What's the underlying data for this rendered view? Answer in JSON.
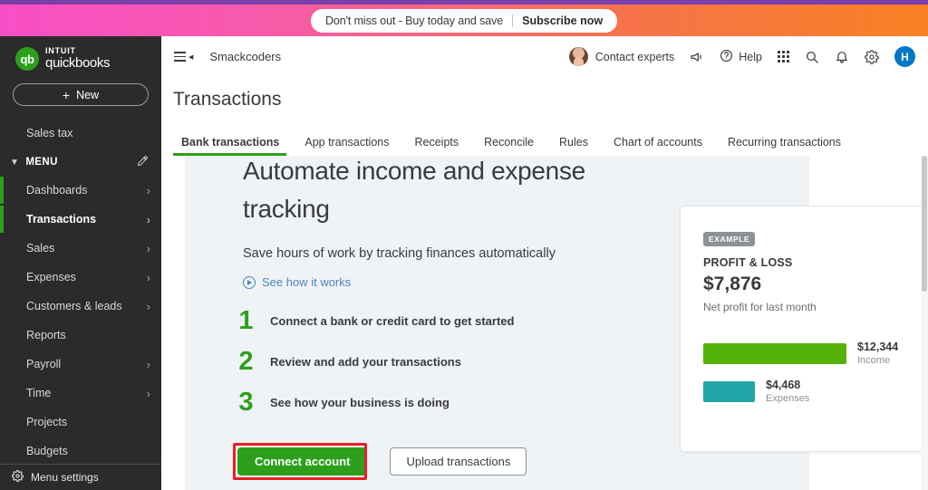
{
  "promo": {
    "message": "Don't miss out - Buy today and save",
    "cta": "Subscribe now"
  },
  "brand": {
    "intuit": "INTUIT",
    "product": "quickbooks",
    "mark": "qb"
  },
  "sidebar": {
    "new_button": "New",
    "new_plus": "+",
    "sales_tax": "Sales tax",
    "menu_group": "MENU",
    "items": [
      {
        "label": "Dashboards",
        "chevron": "›",
        "active": false
      },
      {
        "label": "Transactions",
        "chevron": "›",
        "active": true
      },
      {
        "label": "Sales",
        "chevron": "›",
        "active": false
      },
      {
        "label": "Expenses",
        "chevron": "›",
        "active": false
      },
      {
        "label": "Customers & leads",
        "chevron": "›",
        "active": false
      },
      {
        "label": "Reports",
        "chevron": "",
        "active": false
      },
      {
        "label": "Payroll",
        "chevron": "›",
        "active": false
      },
      {
        "label": "Time",
        "chevron": "›",
        "active": false
      },
      {
        "label": "Projects",
        "chevron": "",
        "active": false
      },
      {
        "label": "Budgets",
        "chevron": "",
        "active": false
      }
    ],
    "footer": "Menu settings"
  },
  "appbar": {
    "company": "Smackcoders",
    "contact_experts": "Contact experts",
    "help": "Help",
    "user_initial": "H"
  },
  "page": {
    "title": "Transactions",
    "tabs": [
      {
        "label": "Bank transactions",
        "active": true
      },
      {
        "label": "App transactions",
        "active": false
      },
      {
        "label": "Receipts",
        "active": false
      },
      {
        "label": "Reconcile",
        "active": false
      },
      {
        "label": "Rules",
        "active": false
      },
      {
        "label": "Chart of accounts",
        "active": false
      },
      {
        "label": "Recurring transactions",
        "active": false
      }
    ]
  },
  "hero": {
    "heading": "Automate income and expense tracking",
    "subheading": "Save hours of work by tracking finances automatically",
    "video_link": "See how it works",
    "steps": [
      {
        "num": "1",
        "text": "Connect a bank or credit card to get started"
      },
      {
        "num": "2",
        "text": "Review and add your transactions"
      },
      {
        "num": "3",
        "text": "See how your business is doing"
      }
    ],
    "primary_button": "Connect account",
    "secondary_button": "Upload transactions"
  },
  "profit_loss_card": {
    "badge": "EXAMPLE",
    "title": "PROFIT & LOSS",
    "amount": "$7,876",
    "caption": "Net profit for last month",
    "income_value": "$12,344",
    "income_label": "Income",
    "expenses_value": "$4,468",
    "expenses_label": "Expenses"
  },
  "chart_data": {
    "type": "bar",
    "title": "PROFIT & LOSS",
    "categories": [
      "Income",
      "Expenses"
    ],
    "values": [
      12344,
      4468
    ],
    "value_labels": [
      "$12,344",
      "$4,468"
    ],
    "colors": [
      "#55B208",
      "#22A5A7"
    ],
    "annotation": "$7,876 Net profit for last month",
    "xlabel": "",
    "ylabel": "",
    "grid": false,
    "legend": "none"
  },
  "colors": {
    "brand_green": "#2CA01C",
    "link_blue": "#4A84C4",
    "accent_blue": "#0077C5",
    "income_green": "#55B208",
    "expense_teal": "#22A5A7",
    "highlight_red": "#ED1C24",
    "sidebar_bg": "#2B2B2B",
    "panel_bg": "#F0F3F5"
  }
}
